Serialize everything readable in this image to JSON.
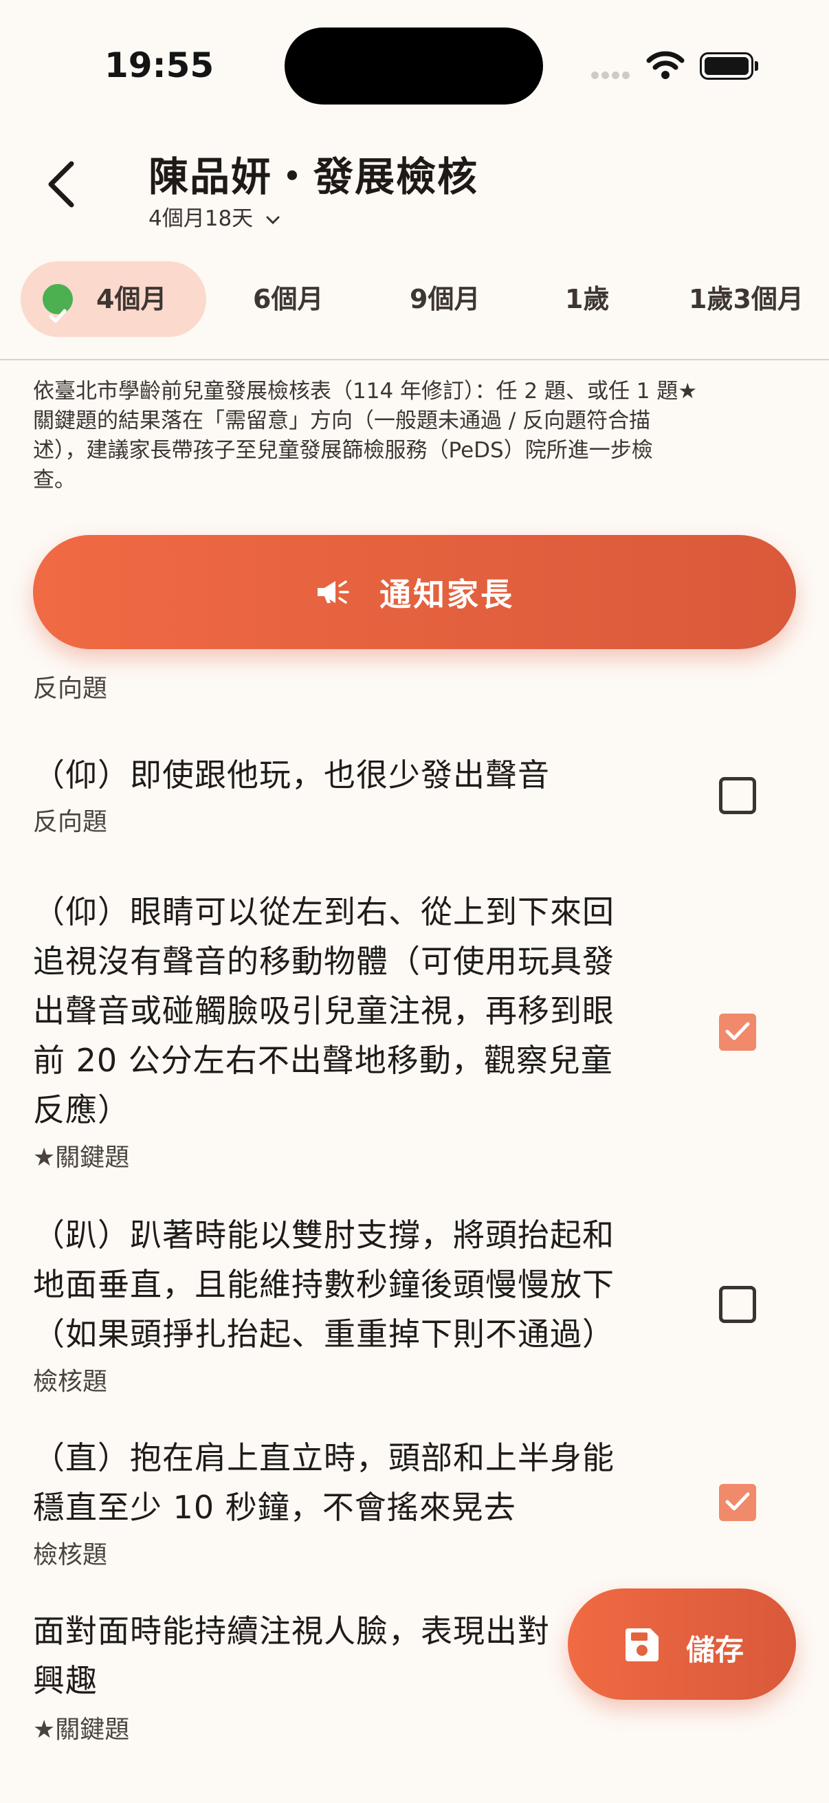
{
  "status_bar": {
    "time": "19:55"
  },
  "header": {
    "title": "陳品妍・發展檢核",
    "subtitle": "4個月18天"
  },
  "tabs": [
    {
      "label": "4個月",
      "active": true,
      "completed": true
    },
    {
      "label": "6個月"
    },
    {
      "label": "9個月"
    },
    {
      "label": "1歲"
    },
    {
      "label": "1歲3個月"
    }
  ],
  "notice": {
    "lines": [
      "依臺北市學齡前兒童發展檢核表（114 年修訂）：任 2 題、或任 1 題★",
      "關鍵題的結果落在「需留意」方向（一般題未通過 / 反向題符合描",
      "述），建議家長帶孩子至兒童發展篩檢服務（PeDS）院所進一步檢",
      "查。"
    ]
  },
  "notify_button": {
    "label": "通知家長"
  },
  "items": [
    {
      "tag": "反向題"
    },
    {
      "lines": [
        "（仰）即使跟他玩，也很少發出聲音"
      ],
      "tag": "反向題",
      "checked": false
    },
    {
      "lines": [
        "（仰）眼睛可以從左到右、從上到下來回",
        "追視沒有聲音的移動物體（可使用玩具發",
        "出聲音或碰觸臉吸引兒童注視，再移到眼",
        "前 20 公分左右不出聲地移動，觀察兒童",
        "反應）"
      ],
      "tag": "★關鍵題",
      "checked": true
    },
    {
      "lines": [
        "（趴）趴著時能以雙肘支撐，將頭抬起和",
        "地面垂直，且能維持數秒鐘後頭慢慢放下",
        "（如果頭掙扎抬起、重重掉下則不通過）"
      ],
      "tag": "檢核題",
      "checked": false
    },
    {
      "lines": [
        "（直）抱在肩上直立時，頭部和上半身能",
        "穩直至少 10 秒鐘，不會搖來晃去"
      ],
      "tag": "檢核題",
      "checked": true
    },
    {
      "lines": [
        "面對面時能持續注視人臉，表現出對",
        "興趣"
      ],
      "tag": "★關鍵題"
    }
  ],
  "save_button": {
    "label": "儲存"
  },
  "colors": {
    "accent": "#ef6a43",
    "checked": "#f08a6a",
    "tab_active_bg": "#fbd9cc",
    "success": "#4caf50"
  }
}
